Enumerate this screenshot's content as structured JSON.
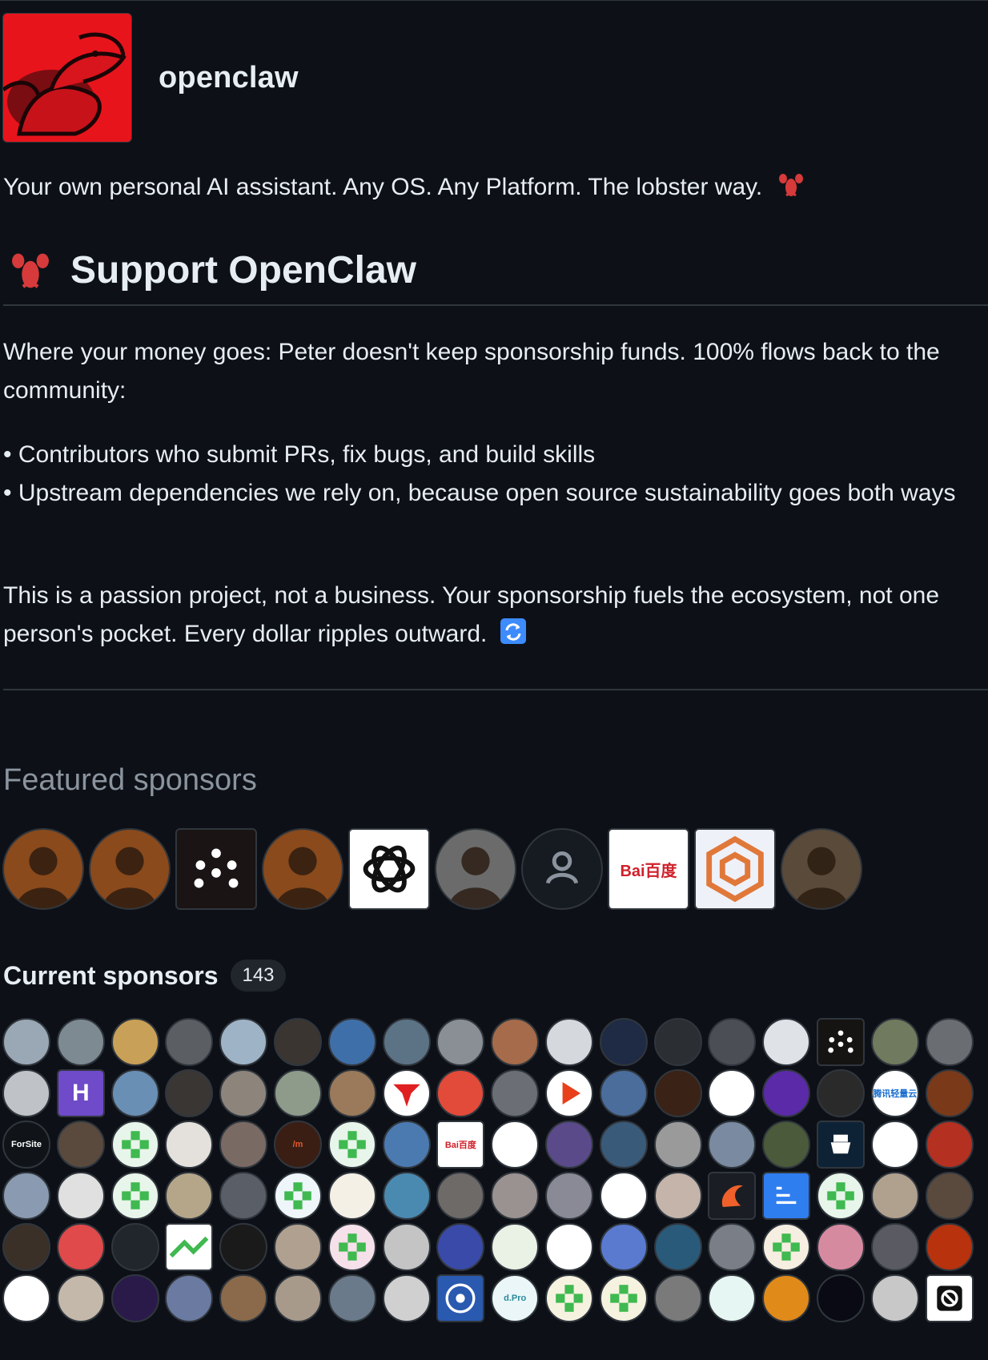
{
  "org": {
    "name": "openclaw",
    "avatar_icon": "lobster-logo-icon",
    "avatar_color": "#e8141c"
  },
  "tagline": "Your own personal AI assistant. Any OS. Any Platform. The lobster way.",
  "support": {
    "heading": "Support OpenClaw",
    "heading_icon": "lobster-emoji-icon",
    "paragraph1": "Where your money goes: Peter doesn't keep sponsorship funds. 100% flows back to the community:",
    "bullets": [
      "• Contributors who submit PRs, fix bugs, and build skills",
      "• Upstream dependencies we rely on, because open source sustainability goes both ways"
    ],
    "paragraph3": "This is a passion project, not a business. Your sponsorship fuels the ecosystem, not one person's pocket. Every dollar ripples outward.",
    "paragraph3_icon": "refresh-emoji-icon"
  },
  "featured": {
    "title": "Featured sponsors",
    "sponsors": [
      {
        "kind": "round",
        "icon": "portrait-avatar-icon",
        "bg": "#8a4a1c"
      },
      {
        "kind": "round",
        "icon": "portrait-avatar-icon",
        "bg": "#8a4a1c"
      },
      {
        "kind": "square",
        "icon": "dots-logo-icon",
        "bg": "#1a1414"
      },
      {
        "kind": "round",
        "icon": "portrait-avatar-icon",
        "bg": "#8a4a1c"
      },
      {
        "kind": "square",
        "icon": "openai-logo-icon",
        "bg": "#ffffff"
      },
      {
        "kind": "round",
        "icon": "portrait-avatar-icon",
        "bg": "#6b6b6b"
      },
      {
        "kind": "round",
        "icon": "default-user-icon",
        "bg": "#161b22"
      },
      {
        "kind": "square",
        "icon": "baidu-logo-icon",
        "bg": "#ffffff",
        "text": "Bai百度"
      },
      {
        "kind": "square",
        "icon": "hexagon-logo-icon",
        "bg": "#eef1f8"
      },
      {
        "kind": "round",
        "icon": "portrait-avatar-icon",
        "bg": "#5a4a3a"
      }
    ]
  },
  "current": {
    "title": "Current sponsors",
    "count": "143",
    "rows": [
      [
        {
          "k": "round",
          "bg": "#9aa7b5"
        },
        {
          "k": "round",
          "bg": "#7d8a92"
        },
        {
          "k": "round",
          "bg": "#c9a057"
        },
        {
          "k": "round",
          "bg": "#5b5f63"
        },
        {
          "k": "round",
          "bg": "#9fb3c6"
        },
        {
          "k": "round",
          "bg": "#3a3530"
        },
        {
          "k": "round",
          "bg": "#3f6fa8"
        },
        {
          "k": "round",
          "bg": "#5c7386"
        },
        {
          "k": "round",
          "bg": "#8a8f96"
        },
        {
          "k": "round",
          "bg": "#a56b4a"
        },
        {
          "k": "round",
          "bg": "#d5d8dc"
        },
        {
          "k": "round",
          "bg": "#1f2b44"
        },
        {
          "k": "round",
          "bg": "#2b2f34"
        },
        {
          "k": "round",
          "bg": "#4b4e55"
        },
        {
          "k": "round",
          "bg": "#dfe3e8"
        },
        {
          "k": "square",
          "bg": "#161412",
          "icon": "dots-logo-icon"
        },
        {
          "k": "round",
          "bg": "#6f7a5e"
        },
        {
          "k": "round",
          "bg": "#6a6d72"
        }
      ],
      [
        {
          "k": "round",
          "bg": "#bfc3c7"
        },
        {
          "k": "square",
          "bg": "#6f4ac9",
          "text": "H",
          "fg": "#ffffff"
        },
        {
          "k": "round",
          "bg": "#6a8fb5"
        },
        {
          "k": "round",
          "bg": "#3a3634"
        },
        {
          "k": "round",
          "bg": "#8d847c"
        },
        {
          "k": "round",
          "bg": "#8e9a8a"
        },
        {
          "k": "round",
          "bg": "#9a7a5a"
        },
        {
          "k": "round",
          "bg": "#ffffff",
          "icon": "red-logo-icon"
        },
        {
          "k": "round",
          "bg": "#e24a3a"
        },
        {
          "k": "round",
          "bg": "#6b6f75"
        },
        {
          "k": "round",
          "bg": "#ffffff",
          "icon": "play-logo-icon"
        },
        {
          "k": "round",
          "bg": "#4a6d9b"
        },
        {
          "k": "round",
          "bg": "#3a2216"
        },
        {
          "k": "round",
          "bg": "#ffffff"
        },
        {
          "k": "round",
          "bg": "#5a2aa8"
        },
        {
          "k": "round",
          "bg": "#2a2a2a"
        },
        {
          "k": "round",
          "bg": "#ffffff",
          "text": "腾讯轻量云",
          "fg": "#1a6fd0"
        },
        {
          "k": "round",
          "bg": "#7a3a1a"
        }
      ],
      [
        {
          "k": "round",
          "bg": "#101418",
          "text": "ForSite",
          "fg": "#ffffff"
        },
        {
          "k": "round",
          "bg": "#5a4a3e"
        },
        {
          "k": "round",
          "bg": "#e8f5ea",
          "icon": "pixel-pattern-icon"
        },
        {
          "k": "round",
          "bg": "#e4e1dc"
        },
        {
          "k": "round",
          "bg": "#7a6a64"
        },
        {
          "k": "round",
          "bg": "#3a1e14",
          "text": "/m",
          "fg": "#e05a2a"
        },
        {
          "k": "round",
          "bg": "#e8f5ea",
          "icon": "pixel-pattern-icon"
        },
        {
          "k": "round",
          "bg": "#4a7ab0"
        },
        {
          "k": "square",
          "bg": "#ffffff",
          "text": "Bai百度",
          "fg": "#d0202a"
        },
        {
          "k": "round",
          "bg": "#ffffff"
        },
        {
          "k": "round",
          "bg": "#5a4a8a"
        },
        {
          "k": "round",
          "bg": "#3a5a7a"
        },
        {
          "k": "round",
          "bg": "#9a9a9a"
        },
        {
          "k": "round",
          "bg": "#7a8aa0"
        },
        {
          "k": "round",
          "bg": "#4a5a3a"
        },
        {
          "k": "square",
          "bg": "#0e2236",
          "icon": "agent-logo-icon"
        },
        {
          "k": "round",
          "bg": "#ffffff"
        },
        {
          "k": "round",
          "bg": "#b43020"
        }
      ],
      [
        {
          "k": "round",
          "bg": "#8a9ab0"
        },
        {
          "k": "round",
          "bg": "#e0e0e0"
        },
        {
          "k": "round",
          "bg": "#e8f5ea",
          "icon": "pixel-pattern-icon"
        },
        {
          "k": "round",
          "bg": "#b5a68a"
        },
        {
          "k": "round",
          "bg": "#5a5e66"
        },
        {
          "k": "round",
          "bg": "#eef6fa",
          "icon": "pixel-pattern-icon"
        },
        {
          "k": "round",
          "bg": "#f4f0e6"
        },
        {
          "k": "round",
          "bg": "#4a8ab0"
        },
        {
          "k": "round",
          "bg": "#6e6a68"
        },
        {
          "k": "round",
          "bg": "#9a9290"
        },
        {
          "k": "round",
          "bg": "#8a8a96"
        },
        {
          "k": "round",
          "bg": "#ffffff"
        },
        {
          "k": "round",
          "bg": "#c4b4aa"
        },
        {
          "k": "square",
          "bg": "#1a1e24",
          "icon": "flame-logo-icon"
        },
        {
          "k": "square",
          "bg": "#2f7ef0",
          "icon": "doc-logo-icon"
        },
        {
          "k": "round",
          "bg": "#e8f5ea",
          "icon": "pixel-pattern-icon"
        },
        {
          "k": "round",
          "bg": "#b0a08e"
        },
        {
          "k": "round",
          "bg": "#5a4a3e"
        }
      ],
      [
        {
          "k": "round",
          "bg": "#3a3028"
        },
        {
          "k": "round",
          "bg": "#e04a4a"
        },
        {
          "k": "round",
          "bg": "#20262c"
        },
        {
          "k": "square",
          "bg": "#ffffff",
          "icon": "chart-logo-icon"
        },
        {
          "k": "round",
          "bg": "#1a1a1a"
        },
        {
          "k": "round",
          "bg": "#b0a090"
        },
        {
          "k": "round",
          "bg": "#f6e0ea",
          "icon": "pixel-pattern-icon"
        },
        {
          "k": "round",
          "bg": "#c4c4c4"
        },
        {
          "k": "round",
          "bg": "#3a4aa8"
        },
        {
          "k": "round",
          "bg": "#eaf2e6"
        },
        {
          "k": "round",
          "bg": "#ffffff"
        },
        {
          "k": "round",
          "bg": "#5a7ad0"
        },
        {
          "k": "round",
          "bg": "#2a5a7a"
        },
        {
          "k": "round",
          "bg": "#7a7e86"
        },
        {
          "k": "round",
          "bg": "#f6eee0",
          "icon": "pixel-pattern-icon"
        },
        {
          "k": "round",
          "bg": "#d68aa0"
        },
        {
          "k": "round",
          "bg": "#5a5a62"
        },
        {
          "k": "round",
          "bg": "#b8320e"
        }
      ],
      [
        {
          "k": "round",
          "bg": "#ffffff"
        },
        {
          "k": "round",
          "bg": "#c4b8aa"
        },
        {
          "k": "round",
          "bg": "#2a1a4a"
        },
        {
          "k": "round",
          "bg": "#6a7aa0"
        },
        {
          "k": "round",
          "bg": "#8a6a4a"
        },
        {
          "k": "round",
          "bg": "#a89a8a"
        },
        {
          "k": "round",
          "bg": "#6a7a8a"
        },
        {
          "k": "round",
          "bg": "#d0d0d0"
        },
        {
          "k": "square",
          "bg": "#2a5ab0",
          "icon": "badge-logo-icon"
        },
        {
          "k": "round",
          "bg": "#eaf6f8",
          "text": "d.Pro",
          "fg": "#2a8a9a"
        },
        {
          "k": "round",
          "bg": "#f6f2e0",
          "icon": "pixel-pattern-icon"
        },
        {
          "k": "round",
          "bg": "#f6f2e0",
          "icon": "pixel-pattern-icon"
        },
        {
          "k": "round",
          "bg": "#7a7a7a"
        },
        {
          "k": "round",
          "bg": "#e6f6f2"
        },
        {
          "k": "round",
          "bg": "#e08a1a"
        },
        {
          "k": "round",
          "bg": "#0a0a14"
        },
        {
          "k": "round",
          "bg": "#c8c8c8"
        },
        {
          "k": "square",
          "bg": "#ffffff",
          "icon": "no-sign-logo-icon"
        }
      ]
    ]
  }
}
